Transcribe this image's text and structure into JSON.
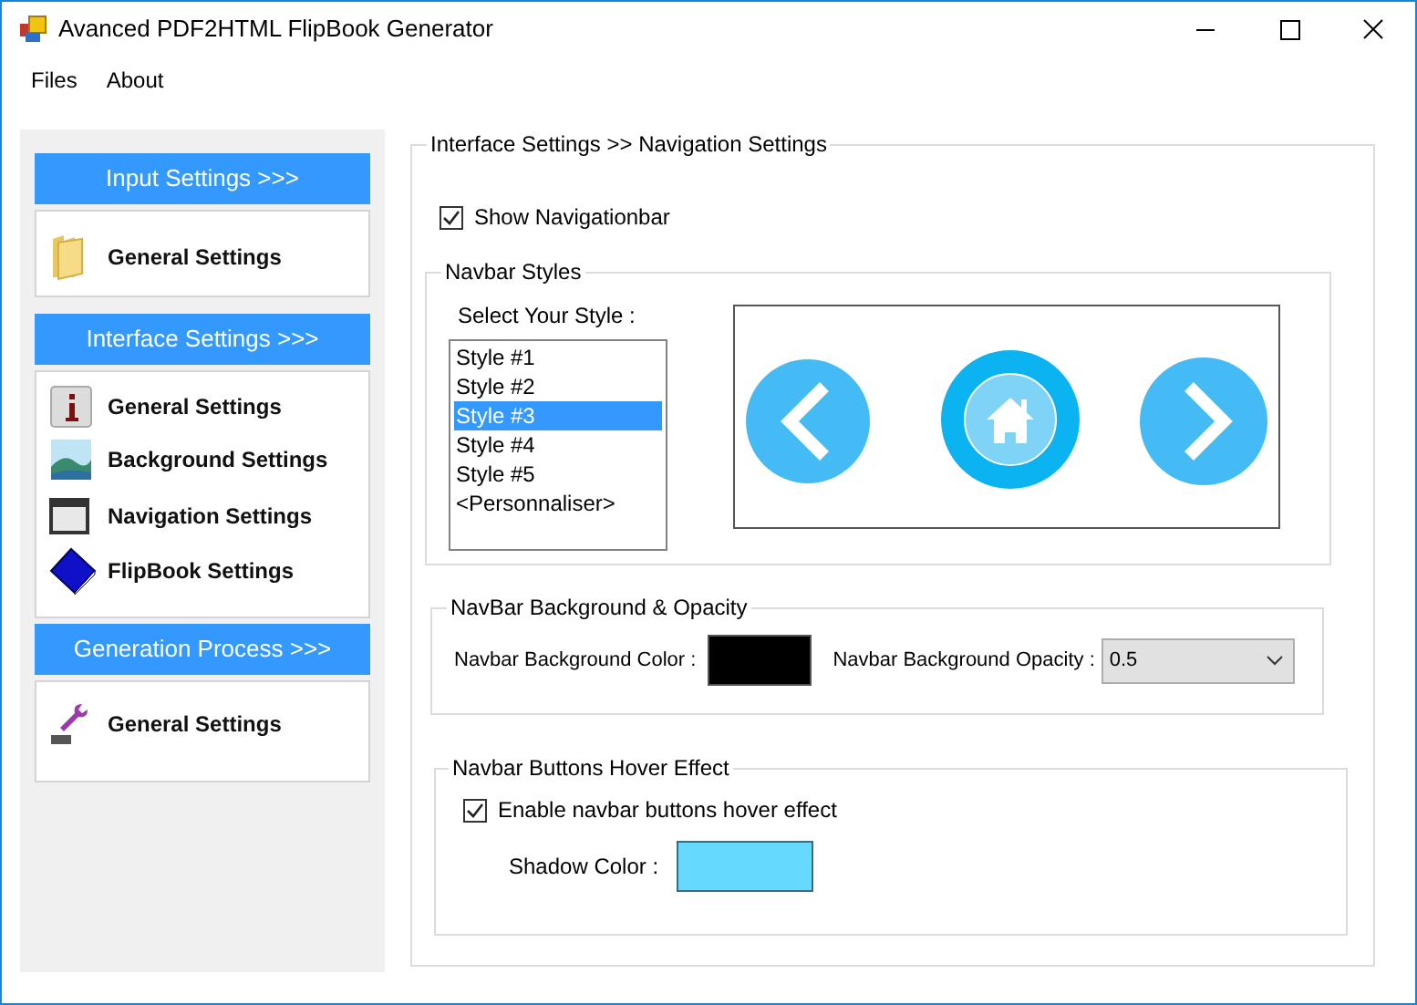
{
  "window": {
    "title": "Avanced PDF2HTML FlipBook Generator"
  },
  "menu": [
    {
      "label": "Files"
    },
    {
      "label": "About"
    }
  ],
  "sidebar": {
    "sections": [
      {
        "header": "Input Settings >>>",
        "items": [
          {
            "label": "General Settings"
          }
        ]
      },
      {
        "header": "Interface Settings >>>",
        "items": [
          {
            "label": "General Settings"
          },
          {
            "label": "Background Settings"
          },
          {
            "label": "Navigation Settings"
          },
          {
            "label": "FlipBook Settings"
          }
        ]
      },
      {
        "header": "Generation Process >>>",
        "items": [
          {
            "label": "General Settings"
          }
        ]
      }
    ]
  },
  "main": {
    "title": "Interface Settings >> Navigation Settings",
    "show_navbar": {
      "label": "Show Navigationbar",
      "checked": true
    },
    "navbar_styles": {
      "title": "Navbar Styles",
      "prompt": "Select Your Style :",
      "styles": [
        {
          "label": "Style #1",
          "selected": false
        },
        {
          "label": "Style #2",
          "selected": false
        },
        {
          "label": "Style #3",
          "selected": true
        },
        {
          "label": "Style #4",
          "selected": false
        },
        {
          "label": "Style #5",
          "selected": false
        },
        {
          "label": "<Personnaliser>",
          "selected": false
        }
      ]
    },
    "background": {
      "title": "NavBar Background & Opacity",
      "color_label": "Navbar Background Color :",
      "color": "#000000",
      "opacity_label": "Navbar Background Opacity :",
      "opacity_value": "0.5"
    },
    "hover": {
      "title": "Navbar Buttons Hover Effect",
      "enable": {
        "label": "Enable navbar buttons hover effect",
        "checked": true
      },
      "shadow": {
        "label": "Shadow Color :",
        "color": "#66d9ff"
      }
    }
  }
}
